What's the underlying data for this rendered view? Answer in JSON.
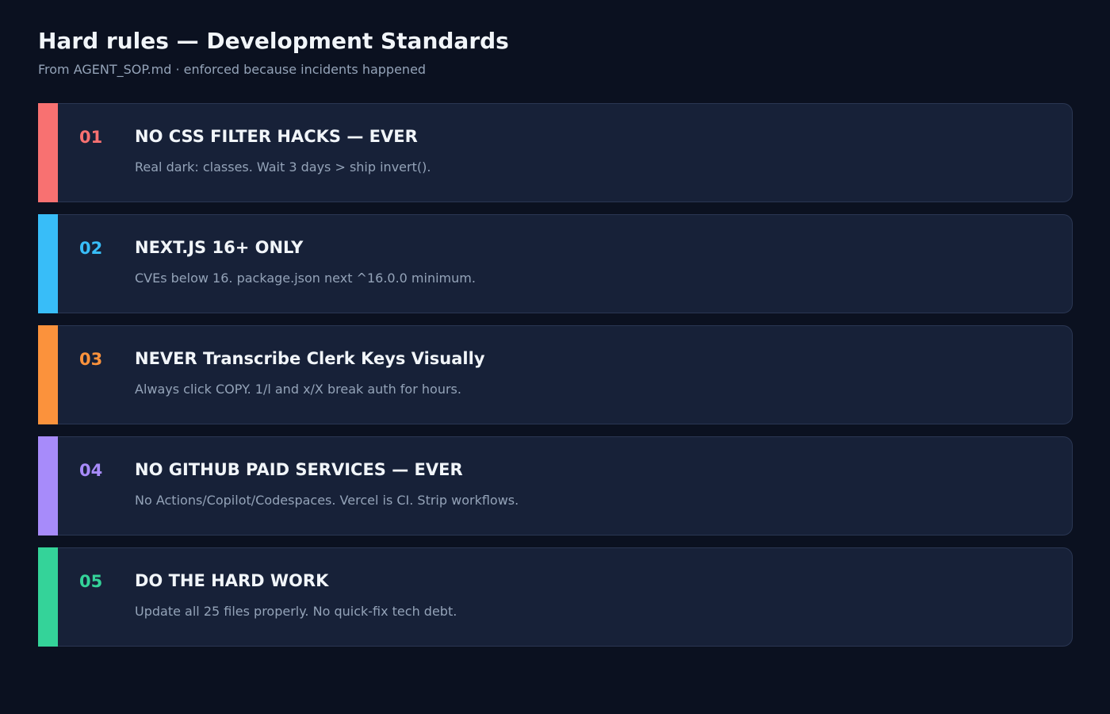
{
  "header": {
    "title": "Hard rules — Development Standards",
    "subtitle": "From AGENT_SOP.md · enforced because incidents happened"
  },
  "rules": [
    {
      "number": "01",
      "title": "NO CSS FILTER HACKS — EVER",
      "description": "Real dark: classes. Wait 3 days > ship invert().",
      "accent_color": "#f87171"
    },
    {
      "number": "02",
      "title": "NEXT.JS 16+ ONLY",
      "description": "CVEs below 16. package.json next ^16.0.0 minimum.",
      "accent_color": "#38bdf8"
    },
    {
      "number": "03",
      "title": "NEVER Transcribe Clerk Keys Visually",
      "description": "Always click COPY. 1/l and x/X break auth for hours.",
      "accent_color": "#fb923c"
    },
    {
      "number": "04",
      "title": "NO GITHUB PAID SERVICES — EVER",
      "description": "No Actions/Copilot/Codespaces. Vercel is CI. Strip workflows.",
      "accent_color": "#a78bfa"
    },
    {
      "number": "05",
      "title": "DO THE HARD WORK",
      "description": "Update all 25 files properly. No quick-fix tech debt.",
      "accent_color": "#34d399"
    }
  ],
  "colors": {
    "background": "#0b1120",
    "card_background": "#172138",
    "card_border": "#2a3652",
    "title_text": "#f1f5f9",
    "muted_text": "#94a3b8"
  }
}
